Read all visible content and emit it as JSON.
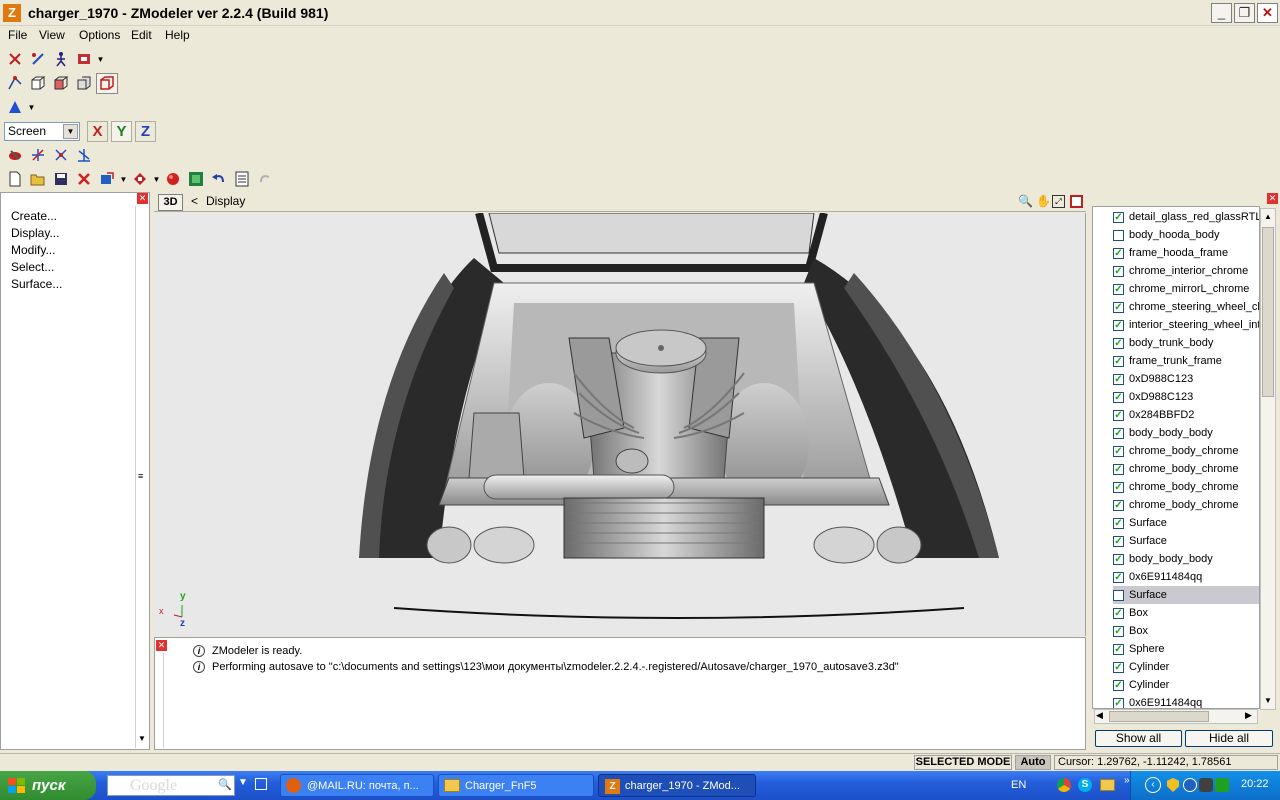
{
  "window": {
    "title": "charger_1970 - ZModeler ver 2.2.4 (Build 981)",
    "minimize": "_",
    "maximize": "❐",
    "close": "✕"
  },
  "menu": [
    "File",
    "View",
    "Options",
    "Edit",
    "Help"
  ],
  "toolbar": {
    "screen_select": "Screen",
    "axis_x": "X",
    "axis_y": "Y",
    "axis_z": "Z"
  },
  "commands": [
    "Create...",
    "Display...",
    "Modify...",
    "Select...",
    "Surface..."
  ],
  "viewport": {
    "tab": "3D",
    "nav": "<",
    "label": "Display",
    "axis_x": "x",
    "axis_y": "y",
    "axis_z": "z"
  },
  "log": [
    "ZModeler is ready.",
    "Performing autosave to \"c:\\documents and settings\\123\\мои документы\\zmodeler.2.2.4.-.registered/Autosave/charger_1970_autosave3.z3d\""
  ],
  "objects": [
    {
      "name": "detail_glass_red_glassRTL_",
      "checked": true
    },
    {
      "name": "body_hooda_body",
      "checked": false
    },
    {
      "name": "frame_hooda_frame",
      "checked": true
    },
    {
      "name": "chrome_interior_chrome",
      "checked": true
    },
    {
      "name": "chrome_mirrorL_chrome",
      "checked": true
    },
    {
      "name": "chrome_steering_wheel_ch",
      "checked": true
    },
    {
      "name": "interior_steering_wheel_int",
      "checked": true
    },
    {
      "name": "body_trunk_body",
      "checked": true
    },
    {
      "name": "frame_trunk_frame",
      "checked": true
    },
    {
      "name": "0xD988C123",
      "checked": true
    },
    {
      "name": "0xD988C123",
      "checked": true
    },
    {
      "name": "0x284BBFD2",
      "checked": true
    },
    {
      "name": "body_body_body",
      "checked": true
    },
    {
      "name": "chrome_body_chrome",
      "checked": true
    },
    {
      "name": "chrome_body_chrome",
      "checked": true
    },
    {
      "name": "chrome_body_chrome",
      "checked": true
    },
    {
      "name": "chrome_body_chrome",
      "checked": true
    },
    {
      "name": "Surface",
      "checked": true
    },
    {
      "name": "Surface",
      "checked": true
    },
    {
      "name": "body_body_body",
      "checked": true
    },
    {
      "name": "0x6E911484qq",
      "checked": true
    },
    {
      "name": "Surface",
      "checked": false,
      "selected": true
    },
    {
      "name": "Box",
      "checked": true
    },
    {
      "name": "Box",
      "checked": true
    },
    {
      "name": "Sphere",
      "checked": true
    },
    {
      "name": "Cylinder",
      "checked": true
    },
    {
      "name": "Cylinder",
      "checked": true
    },
    {
      "name": "0x6E911484qq",
      "checked": true
    }
  ],
  "buttons": {
    "show_all": "Show all",
    "hide_all": "Hide all"
  },
  "status": {
    "mode": "SELECTED MODE",
    "auto": "Auto",
    "cursor": "Cursor: 1.29762, -1.11242, 1.78561"
  },
  "taskbar": {
    "start": "пуск",
    "search_logo": "Google",
    "tasks": [
      "@MAIL.RU: почта, п...",
      "Charger_FnF5",
      "charger_1970 - ZMod..."
    ],
    "lang": "EN",
    "clock": "20:22"
  },
  "colors": {
    "accent": "#e07a10",
    "checked": "#21a121",
    "taskbar": "#245edb",
    "start": "#2f8d2f"
  }
}
